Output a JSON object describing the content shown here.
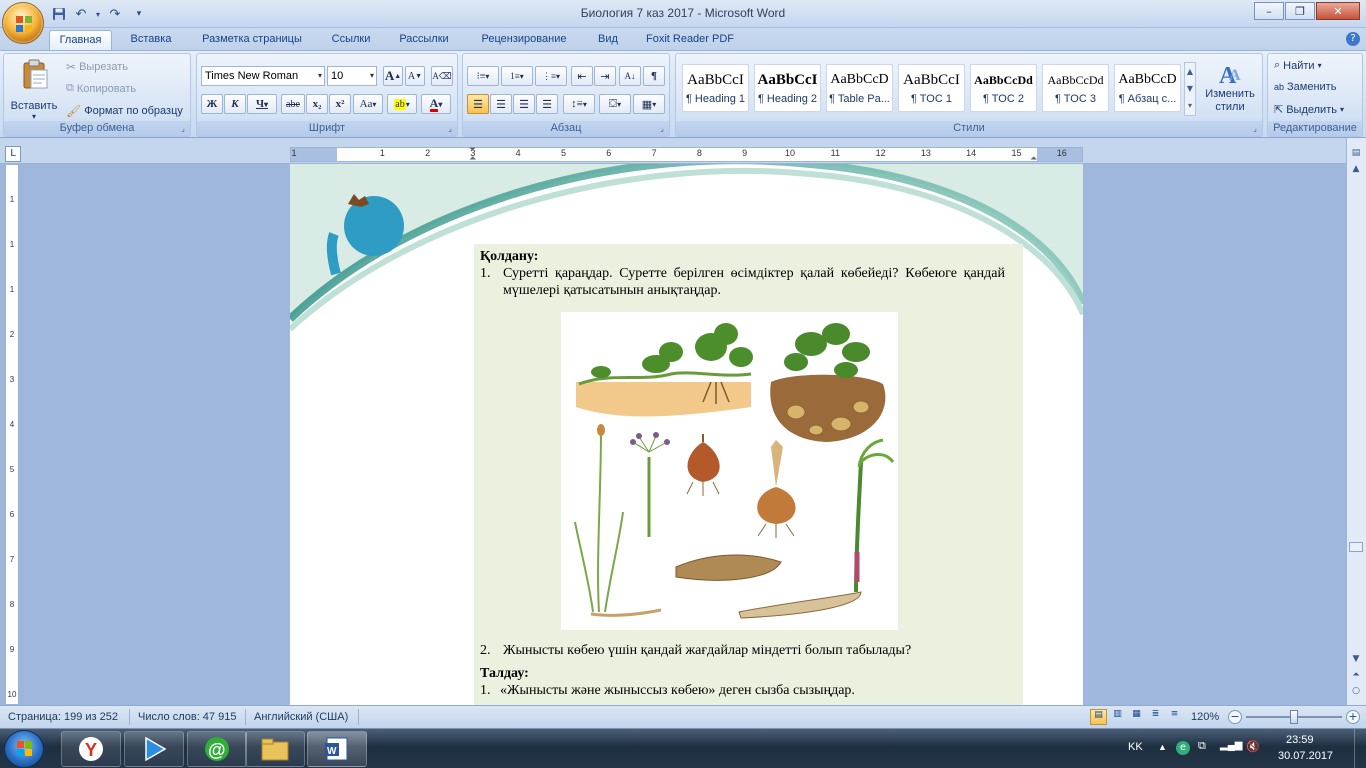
{
  "window": {
    "title": "Биология  7 каз 2017 - Microsoft Word",
    "min_glyph": "–",
    "max_glyph": "❐",
    "close_glyph": "✕"
  },
  "quick_access": [
    {
      "name": "save-icon",
      "glyph": "💾"
    },
    {
      "name": "undo-icon",
      "glyph": "↶"
    },
    {
      "name": "redo-icon",
      "glyph": "↷"
    },
    {
      "name": "customize-qat-icon",
      "glyph": "▾"
    }
  ],
  "tabs": [
    "Главная",
    "Вставка",
    "Разметка страницы",
    "Ссылки",
    "Рассылки",
    "Рецензирование",
    "Вид",
    "Foxit Reader PDF"
  ],
  "active_tab": "Главная",
  "clipboard": {
    "label": "Буфер обмена",
    "paste": "Вставить",
    "cut": "Вырезать",
    "copy": "Копировать",
    "format_painter": "Формат по образцу"
  },
  "font": {
    "label": "Шрифт",
    "font_name": "Times New Roman",
    "font_size": "10",
    "grow": "A",
    "shrink": "A",
    "bold": "Ж",
    "italic": "К",
    "underline": "Ч",
    "strike": "abe",
    "subscript": "x₂",
    "superscript": "x²",
    "change_case": "Aa",
    "highlight": "ab",
    "font_color": "A",
    "highlight_color": "#ffff00",
    "font_color_value": "#e00000"
  },
  "paragraph": {
    "label": "Абзац"
  },
  "styles": {
    "label": "Стили",
    "items": [
      {
        "sample": "AaBbCcI",
        "name": "¶ Heading 1"
      },
      {
        "sample": "AaBbCcI",
        "name": "¶ Heading 2"
      },
      {
        "sample": "AaBbCcD",
        "name": "¶ Table Pa..."
      },
      {
        "sample": "AaBbCcI",
        "name": "¶ TOC 1"
      },
      {
        "sample": "AaBbCcDd",
        "name": "¶ TOC 2"
      },
      {
        "sample": "AaBbCcDd",
        "name": "¶ TOC 3"
      },
      {
        "sample": "AaBbCcD",
        "name": "¶ Абзац с..."
      }
    ],
    "change_styles": "Изменить стили"
  },
  "editing": {
    "label": "Редактирование",
    "find": "Найти",
    "replace": "Заменить",
    "select": "Выделить"
  },
  "ruler": {
    "corner": "L",
    "h_numbers": [
      "1",
      "1",
      "2",
      "3",
      "4",
      "5",
      "6",
      "7",
      "8",
      "9",
      "10",
      "11",
      "12",
      "13",
      "14",
      "15",
      "16"
    ],
    "v_numbers": [
      "1",
      "1",
      "1",
      "2",
      "3",
      "4",
      "5",
      "6",
      "7",
      "8",
      "9",
      "10"
    ]
  },
  "document": {
    "heading_apply": "Қолдану:",
    "item1_num": "1.",
    "item1_text": "Суретті қараңдар. Суретте берілген өсімдіктер қалай көбейеді? Көбеюге қандай мүшелері қатысатынын  анықтаңдар.",
    "item2_num": "2.",
    "item2_text": "Жынысты  көбею  үшін  қандай  жағдайлар  міндетті  болып   табылады?",
    "heading_analysis": "Талдау:",
    "item3_num": "1.",
    "item3_text": "«Жынысты  және  жыныссыз  көбею»  деген  сызба   сызыңдар."
  },
  "status": {
    "page": "Страница: 199 из 252",
    "words": "Число слов: 47 915",
    "language": "Английский (США)",
    "zoom": "120%",
    "zoom_minus": "−",
    "zoom_plus": "+",
    "zoom_level": 0.5
  },
  "taskbar": {
    "apps": [
      {
        "name": "yandex-browser-icon"
      },
      {
        "name": "media-player-icon"
      },
      {
        "name": "mail-agent-icon"
      },
      {
        "name": "file-explorer-icon"
      },
      {
        "name": "word-icon"
      }
    ],
    "language": "KK",
    "time": "23:59",
    "date": "30.07.2017"
  }
}
